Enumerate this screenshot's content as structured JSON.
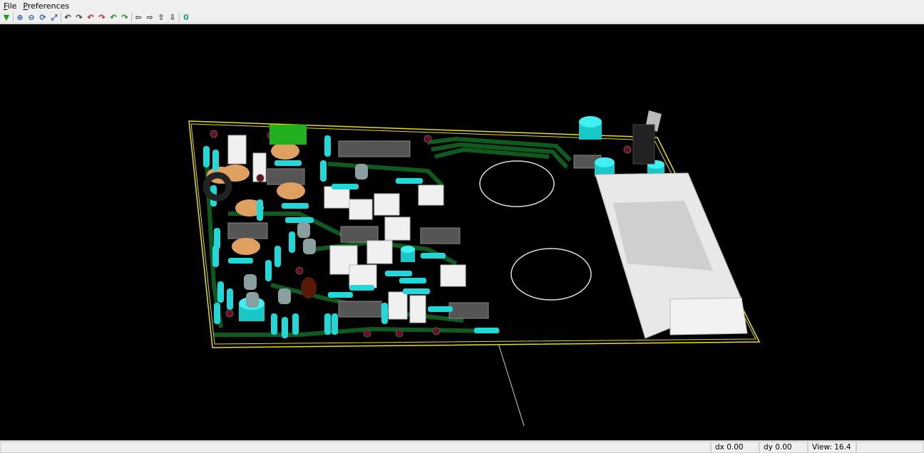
{
  "menu": {
    "file": "File",
    "file_key": "F",
    "file_rest": "ile",
    "preferences": "Preferences",
    "pref_key": "P",
    "pref_rest": "references"
  },
  "toolbar": [
    {
      "icon": "reload-board-icon",
      "glyph": "▼",
      "color": "#1aa01a"
    },
    {
      "icon": "zoom-in-icon",
      "glyph": "⊕",
      "color": "#2a5db0"
    },
    {
      "icon": "zoom-out-icon",
      "glyph": "⊖",
      "color": "#2a5db0"
    },
    {
      "icon": "redraw-icon",
      "glyph": "⟳",
      "color": "#2a5db0"
    },
    {
      "icon": "zoom-fit-icon",
      "glyph": "⤢",
      "color": "#2a5db0"
    },
    {
      "icon": "rotate-x-cw-icon",
      "glyph": "↶",
      "color": "#333"
    },
    {
      "icon": "rotate-x-ccw-icon",
      "glyph": "↷",
      "color": "#333"
    },
    {
      "icon": "rotate-y-cw-icon",
      "glyph": "↶",
      "color": "#c02020"
    },
    {
      "icon": "rotate-y-ccw-icon",
      "glyph": "↷",
      "color": "#c02020"
    },
    {
      "icon": "rotate-z-cw-icon",
      "glyph": "↶",
      "color": "#208020"
    },
    {
      "icon": "rotate-z-ccw-icon",
      "glyph": "↷",
      "color": "#208020"
    },
    {
      "icon": "pan-left-icon",
      "glyph": "⇦",
      "color": "#333"
    },
    {
      "icon": "pan-right-icon",
      "glyph": "⇨",
      "color": "#333"
    },
    {
      "icon": "pan-up-icon",
      "glyph": "⇧",
      "color": "#333"
    },
    {
      "icon": "pan-down-icon",
      "glyph": "⇩",
      "color": "#333"
    },
    {
      "icon": "ortho-toggle-icon",
      "glyph": "0",
      "color": "#10a090"
    }
  ],
  "status": {
    "dx": "dx 0.00",
    "dy": "dy 0.00",
    "view": "View: 16.4"
  },
  "colors": {
    "board_edge": "#e8e000",
    "trace": "#0f5a1e",
    "capacitor": "#20d8d8",
    "ic": "#555555",
    "connector": "#e0e0e0"
  }
}
